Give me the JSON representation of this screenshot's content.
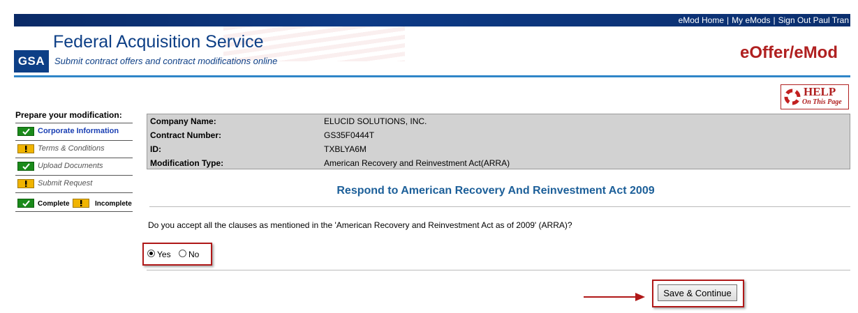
{
  "header": {
    "links": [
      "eMod Home",
      "My eMods",
      "Sign Out Paul Tran"
    ],
    "logo_text": "GSA",
    "title": "Federal Acquisition Service",
    "subtitle": "Submit contract offers and contract modifications online",
    "app_name": "eOffer/eMod",
    "help": {
      "main": "HELP",
      "sub": "On This Page"
    }
  },
  "sidebar": {
    "title": "Prepare your modification:",
    "items": [
      {
        "label": "Corporate Information",
        "status": "complete",
        "current": true
      },
      {
        "label": "Terms & Conditions",
        "status": "incomplete",
        "current": false
      },
      {
        "label": "Upload Documents",
        "status": "complete",
        "current": false
      },
      {
        "label": "Submit Request",
        "status": "incomplete",
        "current": false
      }
    ],
    "legend": {
      "complete": "Complete",
      "incomplete": "Incomplete"
    }
  },
  "info": [
    {
      "key": "Company Name:",
      "value": "ELUCID SOLUTIONS, INC."
    },
    {
      "key": "Contract Number:",
      "value": "GS35F0444T"
    },
    {
      "key": "ID:",
      "value": "TXBLYA6M"
    },
    {
      "key": "Modification Type:",
      "value": "American Recovery and Reinvestment Act(ARRA)"
    }
  ],
  "main": {
    "section_title": "Respond to American Recovery And Reinvestment Act 2009",
    "question": "Do you accept all the clauses as mentioned in the 'American Recovery and Reinvestment Act as of 2009' (ARRA)?",
    "options": {
      "yes": "Yes",
      "no": "No",
      "selected": "Yes"
    },
    "save_label": "Save & Continue"
  },
  "colors": {
    "brand_blue": "#0d3f86",
    "accent_red": "#b02020",
    "title_blue": "#1c5f99",
    "complete_green": "#1a8a1a",
    "incomplete_yellow": "#f0b400"
  }
}
